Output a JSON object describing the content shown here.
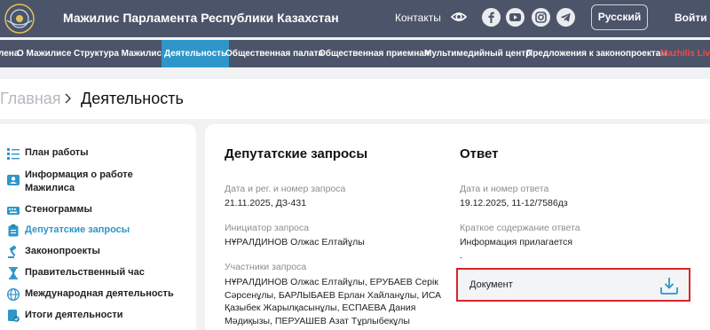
{
  "header": {
    "title": "Мажилис Парламента Республики Казахстан",
    "contacts": "Контакты",
    "language": "Русский",
    "login": "Войти",
    "social": [
      "facebook-icon",
      "youtube-icon",
      "instagram-icon",
      "telegram-icon"
    ]
  },
  "nav": {
    "items": [
      {
        "label": "лена"
      },
      {
        "label": "О Мажилисе"
      },
      {
        "label": "Структура Мажилиса"
      },
      {
        "label": "Деятельность"
      },
      {
        "label": "Общественная палата"
      },
      {
        "label": "Общественная приемная"
      },
      {
        "label": "Мультимедийный центр"
      },
      {
        "label": "Предложения к законопроектам"
      },
      {
        "label": "Mazhilis Live"
      }
    ]
  },
  "breadcrumb": {
    "home": "Главная",
    "current": "Деятельность"
  },
  "sidebar": {
    "items": [
      {
        "label": "План работы"
      },
      {
        "label": "Информация о работе",
        "label2": "Мажилиса"
      },
      {
        "label": "Стенограммы"
      },
      {
        "label": "Депутатские запросы"
      },
      {
        "label": "Законопроекты"
      },
      {
        "label": "Правительственный час"
      },
      {
        "label": "Международная деятельность"
      },
      {
        "label": "Итоги деятельности"
      }
    ]
  },
  "request": {
    "heading": "Депутатские запросы",
    "date_label": "Дата и рег. и номер запроса",
    "date_value": "21.11.2025, ДЗ-431",
    "initiator_label": "Инициатор запроса",
    "initiator_value": "НҰРАЛДИНОВ Олжас Елтайұлы",
    "participants_label": "Участники запроса",
    "participants_value": "НҰРАЛДИНОВ Олжас Елтайұлы, ЕРУБАЕВ Серік Сәрсенұлы, БАРЛЫБАЕВ Ерлан Хайланұлы, ИСА Қазыбек Жарылқасынұлы, ЕСПАЕВА Дания Мәдиқызы, ПЕРУАШЕВ Азат Тұрлыбекұлы"
  },
  "answer": {
    "heading": "Ответ",
    "date_label": "Дата и номер ответа",
    "date_value": "19.12.2025, 11-12/7586дз",
    "summary_label": "Краткое содержание ответа",
    "summary_value": "Информация прилагается",
    "dot": ".",
    "document_label": "Документ"
  },
  "colors": {
    "header_bg": "#4c5469",
    "accent": "#2e96c9",
    "highlight_border": "#d9252a",
    "live": "#ef4b4b"
  }
}
